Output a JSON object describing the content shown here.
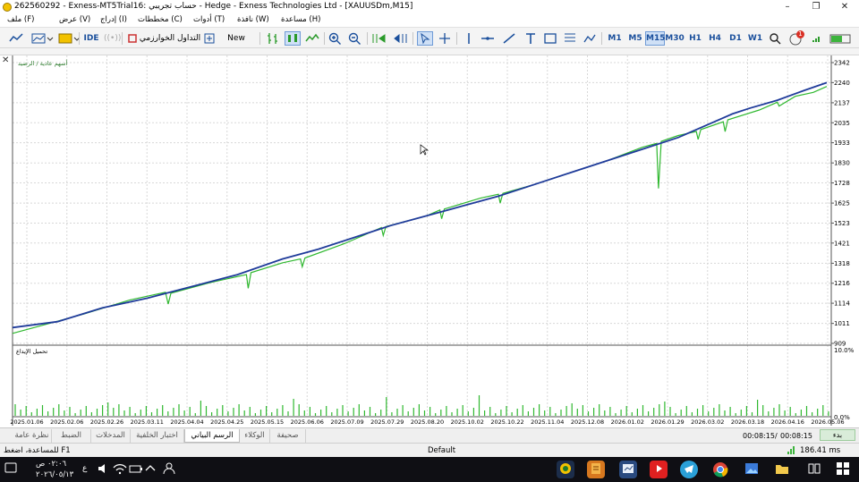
{
  "window": {
    "title": "262560292 - Exness-MT5Trial16: حساب تجريبي - Hedge - Exness Technologies Ltd - [XAUUSDm,M15]",
    "min_glyph": "–",
    "restore_glyph": "❐",
    "close_glyph": "✕"
  },
  "menu": [
    {
      "label": "ملف (F)"
    },
    {
      "label": "عرض (V)"
    },
    {
      "label": "إدراج (I)"
    },
    {
      "label": "مخططات (C)"
    },
    {
      "label": "أدوات (T)"
    },
    {
      "label": "نافذة (W)"
    },
    {
      "label": "مساعدة (H)"
    }
  ],
  "toolbar": {
    "ide": "IDE",
    "algo_trading": "التداول الخوارزمي",
    "new_order": "New Order",
    "timeframes": [
      "M1",
      "M5",
      "M15",
      "M30",
      "H1",
      "H4",
      "D1",
      "W1"
    ],
    "active_timeframe": "M15",
    "notif_count": "1"
  },
  "chart": {
    "legend": "أسهم عادية / الرصيد",
    "indicator_label": "تحميل الإيداع",
    "colors": {
      "balance": "#1f3b9a",
      "equity": "#2fb82f",
      "grid": "#d8d8d8",
      "load": "#2fb82f"
    }
  },
  "chart_data": {
    "type": "line",
    "x_ticks": [
      "2025.01.06",
      "2025.02.06",
      "2025.02.26",
      "2025.03.11",
      "2025.04.04",
      "2025.04.25",
      "2025.05.15",
      "2025.06.06",
      "2025.07.09",
      "2025.07.29",
      "2025.08.20",
      "2025.10.02",
      "2025.10.22",
      "2025.11.04",
      "2025.12.08",
      "2026.01.02",
      "2026.01.29",
      "2026.03.02",
      "2026.03.18",
      "2026.04.16",
      "2026.05.06"
    ],
    "y_ticks": [
      909,
      1011,
      1114,
      1216,
      1318,
      1421,
      1523,
      1625,
      1728,
      1830,
      1933,
      2035,
      2137,
      2240,
      2342
    ],
    "ylim": [
      909,
      2342
    ],
    "series": [
      {
        "name": "الرصيد",
        "points": [
          [
            0,
            990
          ],
          [
            50,
            1020
          ],
          [
            100,
            1090
          ],
          [
            150,
            1140
          ],
          [
            200,
            1200
          ],
          [
            250,
            1260
          ],
          [
            300,
            1340
          ],
          [
            340,
            1390
          ],
          [
            380,
            1450
          ],
          [
            420,
            1510
          ],
          [
            460,
            1560
          ],
          [
            500,
            1610
          ],
          [
            540,
            1660
          ],
          [
            580,
            1720
          ],
          [
            620,
            1780
          ],
          [
            660,
            1840
          ],
          [
            700,
            1900
          ],
          [
            740,
            1960
          ],
          [
            760,
            2000
          ],
          [
            780,
            2040
          ],
          [
            800,
            2080
          ],
          [
            820,
            2110
          ],
          [
            850,
            2150
          ],
          [
            880,
            2200
          ],
          [
            905,
            2240
          ]
        ]
      },
      {
        "name": "أسهم عادية",
        "points": [
          [
            0,
            960
          ],
          [
            40,
            1010
          ],
          [
            80,
            1060
          ],
          [
            130,
            1130
          ],
          [
            170,
            1170
          ],
          [
            173,
            1110
          ],
          [
            176,
            1165
          ],
          [
            220,
            1220
          ],
          [
            260,
            1260
          ],
          [
            262,
            1190
          ],
          [
            265,
            1270
          ],
          [
            300,
            1320
          ],
          [
            320,
            1340
          ],
          [
            322,
            1300
          ],
          [
            325,
            1345
          ],
          [
            370,
            1420
          ],
          [
            410,
            1500
          ],
          [
            412,
            1460
          ],
          [
            415,
            1505
          ],
          [
            460,
            1560
          ],
          [
            475,
            1590
          ],
          [
            477,
            1545
          ],
          [
            480,
            1595
          ],
          [
            520,
            1650
          ],
          [
            540,
            1670
          ],
          [
            542,
            1625
          ],
          [
            545,
            1675
          ],
          [
            580,
            1720
          ],
          [
            620,
            1780
          ],
          [
            660,
            1840
          ],
          [
            700,
            1910
          ],
          [
            716,
            1930
          ],
          [
            718,
            1700
          ],
          [
            721,
            1940
          ],
          [
            740,
            1970
          ],
          [
            760,
            1990
          ],
          [
            762,
            1950
          ],
          [
            765,
            2000
          ],
          [
            790,
            2040
          ],
          [
            792,
            1990
          ],
          [
            795,
            2050
          ],
          [
            830,
            2100
          ],
          [
            850,
            2140
          ],
          [
            852,
            2120
          ],
          [
            870,
            2170
          ],
          [
            890,
            2190
          ],
          [
            905,
            2220
          ]
        ]
      }
    ],
    "deposit_load": {
      "yticks": [
        "10.0%",
        "0.0%"
      ],
      "ylim": [
        0,
        10
      ]
    }
  },
  "tabs": {
    "items": [
      "نظرة عامة",
      "الضبط",
      "المدخلات",
      "اختبار الخلفية",
      "الرسم البياني",
      "الوكلاء",
      "صحيفة"
    ],
    "active": "الرسم البياني",
    "time_elapsed": "00:08:15",
    "time_total": "00:08:15",
    "start": "بدء"
  },
  "status": {
    "help": "للمساعدة، اضغط F1",
    "profile": "Default",
    "ping": "186.41 ms"
  },
  "taskbar": {
    "time": "٠٢:٠٦ ص",
    "date": "٢٠٢٦/٠٥/١٣",
    "lang": "ع"
  }
}
